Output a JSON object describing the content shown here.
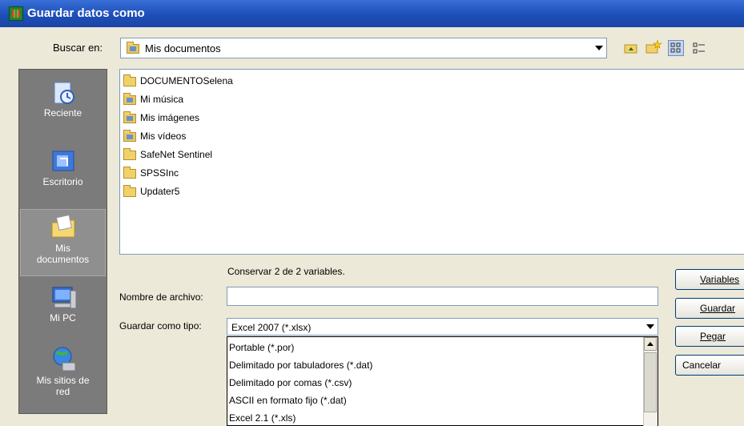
{
  "window": {
    "title": "Guardar datos como"
  },
  "lookin": {
    "label": "Buscar en:",
    "value": "Mis documentos"
  },
  "places": [
    {
      "label": "Reciente"
    },
    {
      "label": "Escritorio"
    },
    {
      "label": "Mis documentos"
    },
    {
      "label": "Mi PC"
    },
    {
      "label": "Mis sitios de red"
    }
  ],
  "files": [
    {
      "name": "DOCUMENTOSelena",
      "icon": "folder-icon"
    },
    {
      "name": "Mi música",
      "icon": "music-folder-icon"
    },
    {
      "name": "Mis imágenes",
      "icon": "pictures-folder-icon"
    },
    {
      "name": "Mis vídeos",
      "icon": "videos-folder-icon"
    },
    {
      "name": "SafeNet Sentinel",
      "icon": "folder-icon"
    },
    {
      "name": "SPSSInc",
      "icon": "folder-icon"
    },
    {
      "name": "Updater5",
      "icon": "folder-icon"
    }
  ],
  "keep_text": "Conservar 2 de 2 variables.",
  "filename": {
    "label": "Nombre de archivo:",
    "value": ""
  },
  "savetype": {
    "label": "Guardar como tipo:",
    "value": "Excel 2007 (*.xlsx)",
    "options": [
      "Portable (*.por)",
      "Delimitado por tabuladores (*.dat)",
      "Delimitado por comas (*.csv)",
      "ASCII en formato fijo (*.dat)",
      "Excel 2.1 (*.xls)"
    ]
  },
  "buttons": {
    "variables": "Variables",
    "save": "Guardar",
    "paste": "Pegar",
    "cancel": "Cancelar"
  }
}
